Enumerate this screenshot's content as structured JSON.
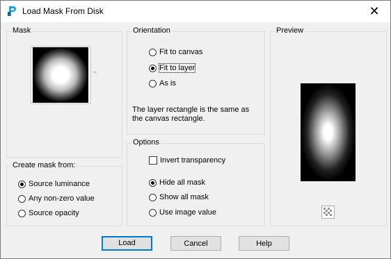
{
  "window": {
    "title": "Load Mask From Disk",
    "close_glyph": "✕"
  },
  "mask": {
    "label": "Mask"
  },
  "create_from": {
    "label": "Create mask from:",
    "options": [
      {
        "label": "Source luminance",
        "checked": true
      },
      {
        "label": "Any non-zero value",
        "checked": false
      },
      {
        "label": "Source opacity",
        "checked": false
      }
    ]
  },
  "orientation": {
    "label": "Orientation",
    "options": [
      {
        "label": "Fit to canvas",
        "checked": false
      },
      {
        "label": "Fit to layer",
        "checked": true
      },
      {
        "label": "As is",
        "checked": false
      }
    ],
    "info": "The layer rectangle is the same as the canvas rectangle."
  },
  "options": {
    "label": "Options",
    "invert_label": "Invert transparency",
    "invert_checked": false,
    "radios": [
      {
        "label": "Hide all mask",
        "checked": true
      },
      {
        "label": "Show all mask",
        "checked": false
      },
      {
        "label": "Use image value",
        "checked": false
      }
    ]
  },
  "preview": {
    "label": "Preview"
  },
  "buttons": {
    "load": "Load",
    "cancel": "Cancel",
    "help": "Help"
  },
  "colors": {
    "accent": "#0078d7",
    "app_icon": "#1ba1e2"
  }
}
